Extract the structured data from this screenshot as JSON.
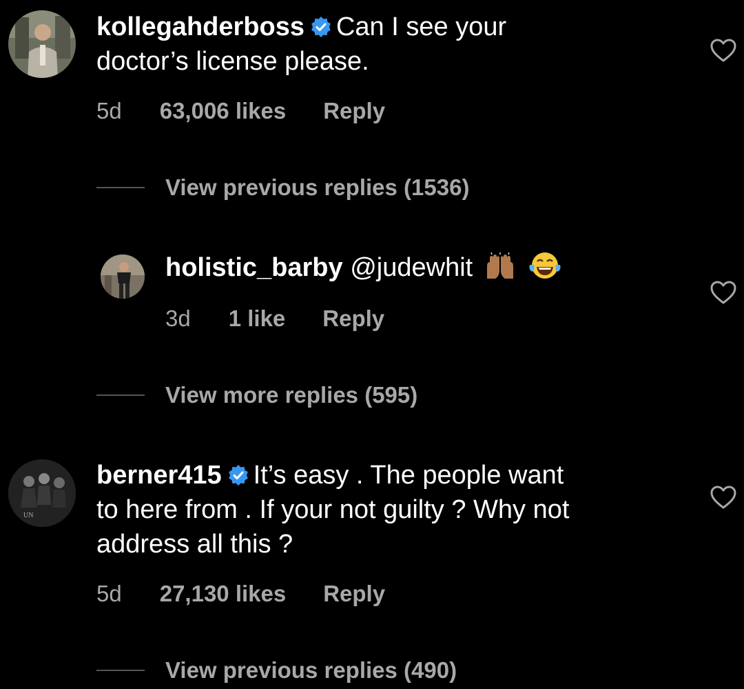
{
  "comments": [
    {
      "username": "kollegahderboss",
      "verified": true,
      "text_line1": "Can I see your",
      "text_line2": "doctor’s license please.",
      "time": "5d",
      "likes": "63,006 likes",
      "reply": "Reply"
    },
    {
      "username": "berner415",
      "verified": true,
      "text_line1": "It’s easy . The people want",
      "text_line2": "to here from . If your not guilty ? Why not",
      "text_line3": "address all this ?",
      "time": "5d",
      "likes": "27,130 likes",
      "reply": "Reply"
    }
  ],
  "reply_thread": {
    "username": "holistic_barby",
    "mention": "@judewhit",
    "emojis": [
      "raising-hands-emoji",
      "tears-of-joy-emoji"
    ],
    "time": "3d",
    "likes": "1 like",
    "reply": "Reply"
  },
  "view_links": {
    "previous_1": "View previous replies (1536)",
    "more_1": "View more replies (595)",
    "previous_2": "View previous replies (490)"
  },
  "colors": {
    "background": "#000000",
    "text": "#ffffff",
    "secondary_text": "#a8a8a8",
    "verified_badge": "#3897f0"
  }
}
